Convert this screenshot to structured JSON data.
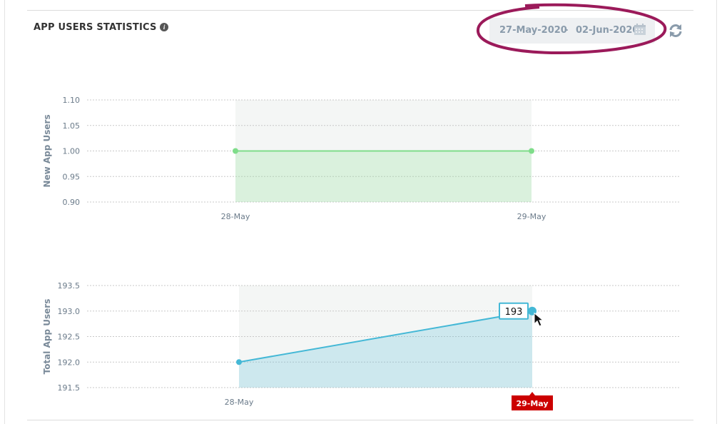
{
  "panel": {
    "title": "APP USERS STATISTICS",
    "info_icon": "info-circle-icon"
  },
  "date_range": {
    "start": "27-May-2020",
    "separator": "-",
    "end": "02-Jun-2020",
    "calendar_icon": "calendar-icon",
    "refresh_icon": "refresh-icon",
    "highlight_color": "#9b1a5a"
  },
  "chart_data": [
    {
      "type": "area",
      "ylabel": "New App Users",
      "categories": [
        "28-May",
        "29-May"
      ],
      "series": [
        {
          "values": [
            1.0,
            1.0
          ]
        }
      ],
      "ylim": [
        0.9,
        1.1
      ],
      "yticks": [
        "1.10",
        "1.05",
        "1.00",
        "0.95",
        "0.90"
      ],
      "ytick_values": [
        1.1,
        1.05,
        1.0,
        0.95,
        0.9
      ],
      "grid": true,
      "color": "#7fdd8a"
    },
    {
      "type": "area",
      "ylabel": "Total App Users",
      "categories": [
        "28-May",
        "29-May"
      ],
      "series": [
        {
          "values": [
            192,
            193
          ]
        }
      ],
      "ylim": [
        191.5,
        193.5
      ],
      "yticks": [
        "193.5",
        "193.0",
        "192.5",
        "192.0",
        "191.5"
      ],
      "ytick_values": [
        193.5,
        193.0,
        192.5,
        192.0,
        191.5
      ],
      "grid": true,
      "color": "#44b8d6",
      "tooltip": {
        "value": "193"
      },
      "highlighted_category": "29-May",
      "highlight_color": "#cc0000"
    }
  ]
}
